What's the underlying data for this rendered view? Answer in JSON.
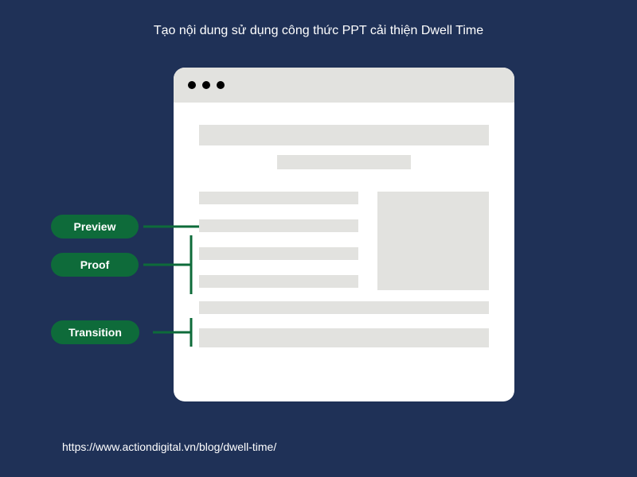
{
  "title": "Tạo nội dung sử dụng công thức PPT cải thiện Dwell Time",
  "tags": {
    "preview": "Preview",
    "proof": "Proof",
    "transition": "Transition"
  },
  "source_url": "https://www.actiondigital.vn/blog/dwell-time/",
  "colors": {
    "background": "#1f3157",
    "tag_bg": "#0e6b3a",
    "placeholder": "#e2e2df"
  }
}
